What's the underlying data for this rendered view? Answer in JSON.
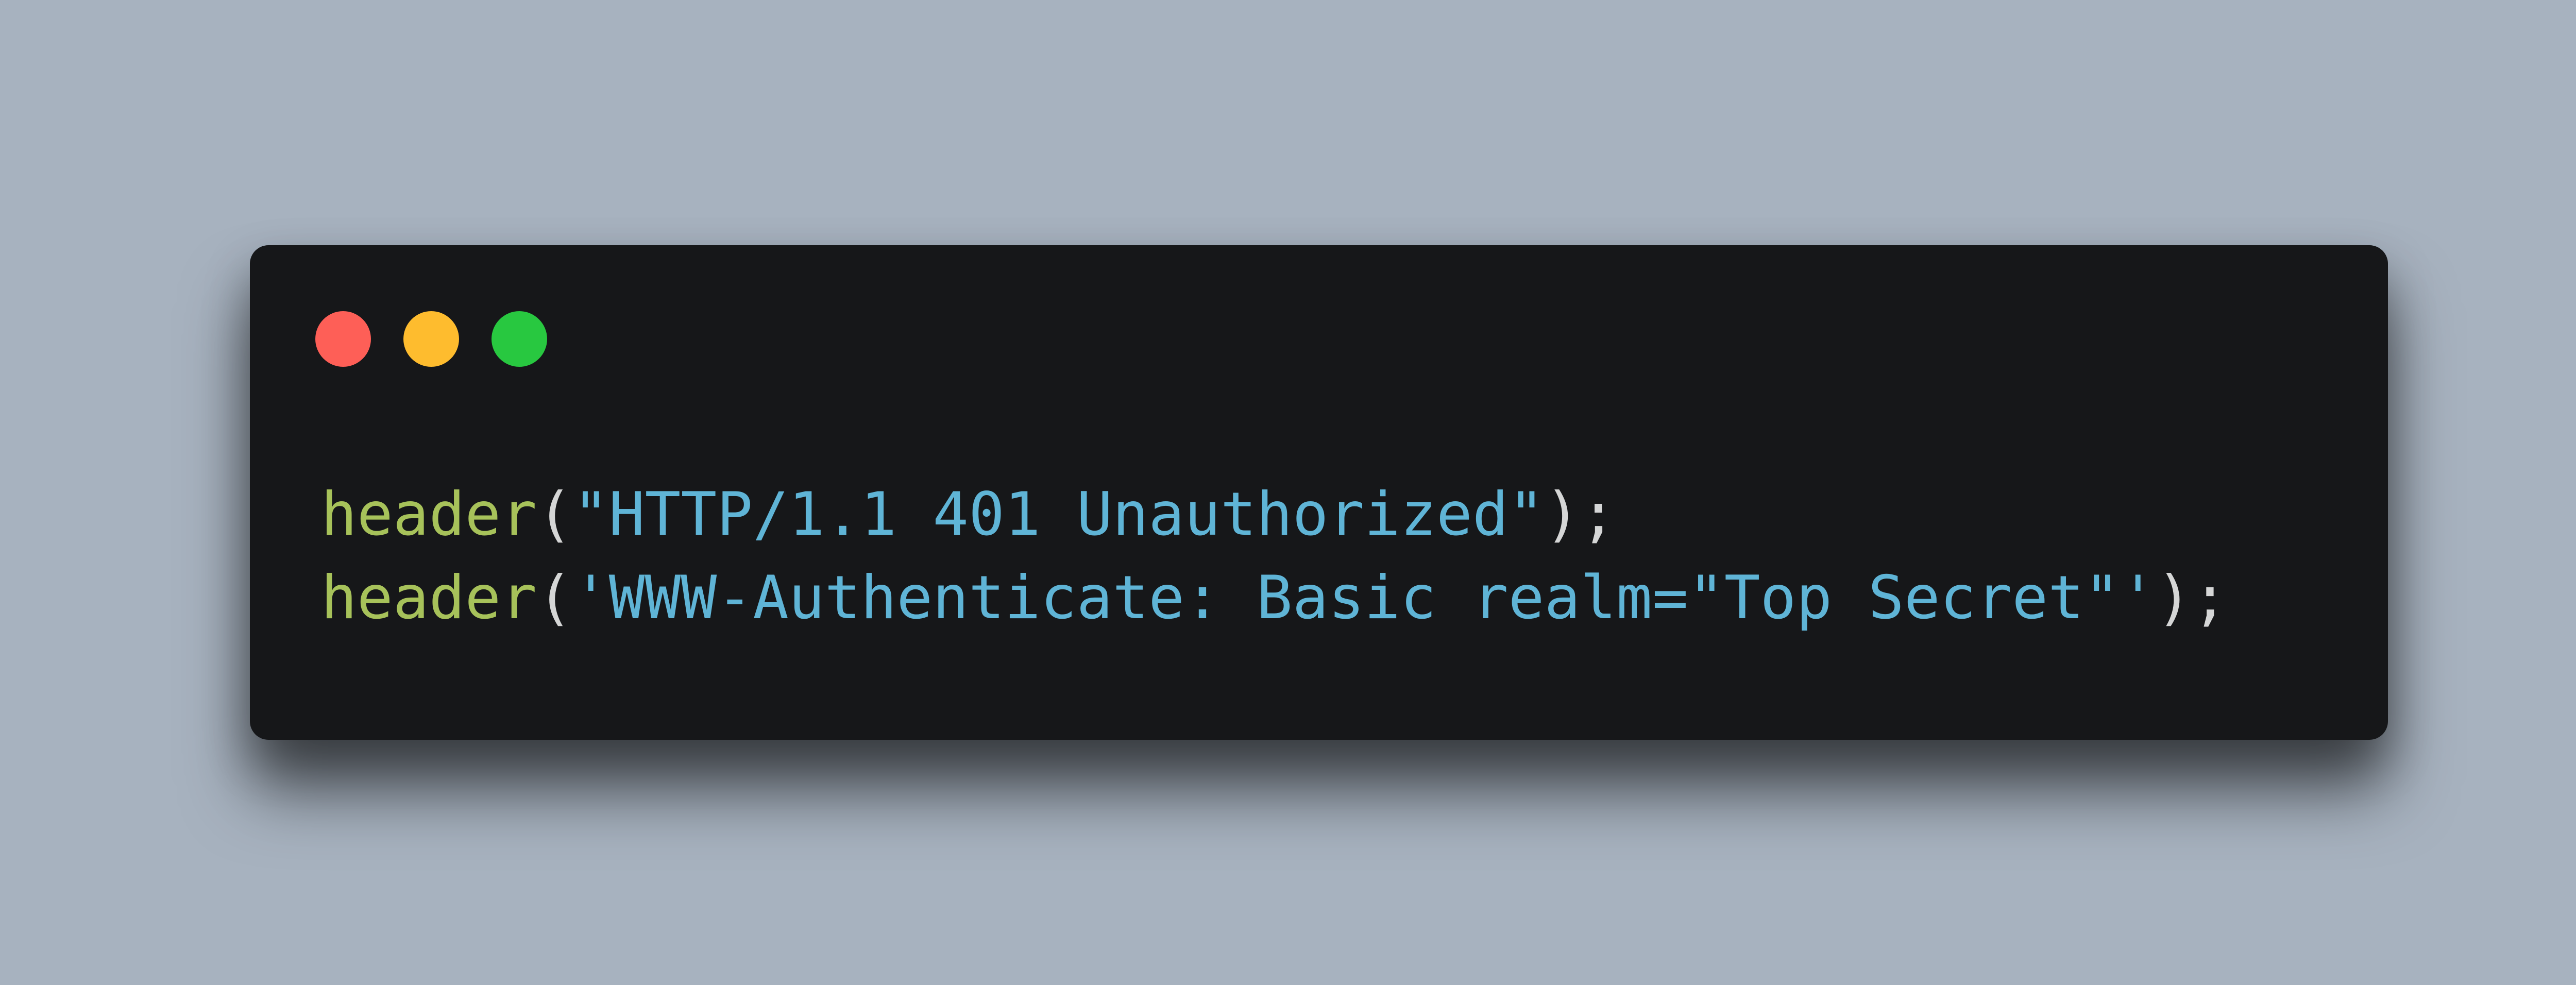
{
  "window": {
    "controls": [
      {
        "name": "close",
        "color": "#fe5f57"
      },
      {
        "name": "minimize",
        "color": "#febc2e"
      },
      {
        "name": "maximize",
        "color": "#28c840"
      }
    ]
  },
  "colors": {
    "background": "#a7b2bf",
    "window": "#161719",
    "function": "#a7c25a",
    "string": "#5fb4d6",
    "punctuation": "#d5d6d6"
  },
  "code": {
    "lines": [
      {
        "fn": "header",
        "open": "(",
        "string": "\"HTTP/1.1 401 Unauthorized\"",
        "close": ");"
      },
      {
        "fn": "header",
        "open": "(",
        "string": "'WWW-Authenticate: Basic realm=\"Top Secret\"'",
        "close": ");"
      }
    ]
  }
}
